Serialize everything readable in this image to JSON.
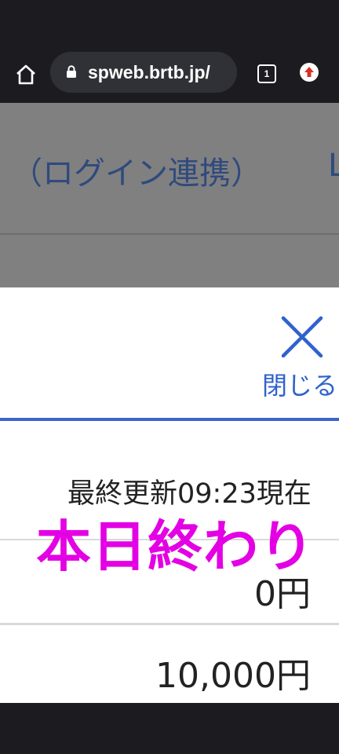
{
  "browser": {
    "url": "spweb.brtb.jp/",
    "tab_count": "1",
    "icons": {
      "home": "home-icon",
      "lock": "lock-icon",
      "tabs": "tabs-icon",
      "menu": "update-arrow-icon"
    }
  },
  "background_page": {
    "heading": "（ログイン連携）",
    "heading_cut": "L"
  },
  "panel": {
    "close_label": "閉じる",
    "updated": "最終更新09:23現在",
    "status": "本日終わり",
    "amount_1": "0円",
    "amount_2": "10,000円",
    "colors": {
      "accent": "#3a66c9",
      "status": "#e400e4"
    }
  }
}
